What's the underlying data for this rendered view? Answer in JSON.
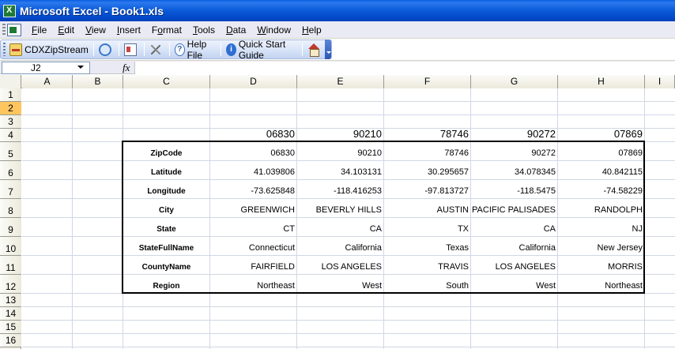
{
  "window": {
    "title": "Microsoft Excel - Book1.xls"
  },
  "menu": {
    "items": [
      {
        "pre": "",
        "u": "F",
        "post": "ile"
      },
      {
        "pre": "",
        "u": "E",
        "post": "dit"
      },
      {
        "pre": "",
        "u": "V",
        "post": "iew"
      },
      {
        "pre": "",
        "u": "I",
        "post": "nsert"
      },
      {
        "pre": "F",
        "u": "o",
        "post": "rmat"
      },
      {
        "pre": "",
        "u": "T",
        "post": "ools"
      },
      {
        "pre": "",
        "u": "D",
        "post": "ata"
      },
      {
        "pre": "",
        "u": "W",
        "post": "indow"
      },
      {
        "pre": "",
        "u": "H",
        "post": "elp"
      }
    ]
  },
  "toolbar": {
    "zipstream_label": "CDXZipStream",
    "help_file_label": "Help File",
    "quick_start_label": "Quick Start Guide",
    "icons": [
      "zip-icon",
      "refresh-icon",
      "card-icon",
      "tools-icon",
      "help-icon",
      "info-icon",
      "home-icon"
    ]
  },
  "formula_bar": {
    "name_box": "J2",
    "fx_label": "fx",
    "formula": ""
  },
  "columns": [
    "A",
    "B",
    "C",
    "D",
    "E",
    "F",
    "G",
    "H",
    "I"
  ],
  "rows": [
    "1",
    "2",
    "3",
    "4",
    "5",
    "6",
    "7",
    "8",
    "9",
    "10",
    "11",
    "12",
    "13",
    "14",
    "15",
    "16"
  ],
  "selected_row": "2",
  "header_row_values": [
    "06830",
    "90210",
    "78746",
    "90272",
    "07869"
  ],
  "table": {
    "labels": [
      "ZipCode",
      "Latitude",
      "Longitude",
      "City",
      "State",
      "StateFullName",
      "CountyName",
      "Region"
    ],
    "data": [
      [
        "06830",
        "90210",
        "78746",
        "90272",
        "07869"
      ],
      [
        "41.039806",
        "34.103131",
        "30.295657",
        "34.078345",
        "40.842115"
      ],
      [
        "-73.625848",
        "-118.416253",
        "-97.813727",
        "-118.5475",
        "-74.58229"
      ],
      [
        "GREENWICH",
        "BEVERLY HILLS",
        "AUSTIN",
        "PACIFIC PALISADES",
        "RANDOLPH"
      ],
      [
        "CT",
        "CA",
        "TX",
        "CA",
        "NJ"
      ],
      [
        "Connecticut",
        "California",
        "Texas",
        "California",
        "New Jersey"
      ],
      [
        "FAIRFIELD",
        "LOS ANGELES",
        "TRAVIS",
        "LOS ANGELES",
        "MORRIS"
      ],
      [
        "Northeast",
        "West",
        "South",
        "West",
        "Northeast"
      ]
    ]
  }
}
